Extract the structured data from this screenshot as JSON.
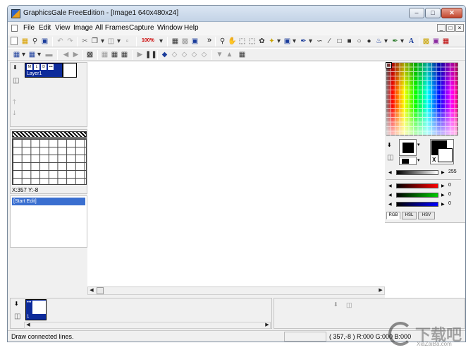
{
  "window": {
    "title": "GraphicsGale FreeEdition - [Image1 640x480x24]",
    "minimize_glyph": "–",
    "maximize_glyph": "□",
    "close_glyph": "✕"
  },
  "menu": [
    "File",
    "Edit",
    "View",
    "Image",
    "All Frames",
    "Capture",
    "Window",
    "Help"
  ],
  "mdi_controls": [
    "_",
    "□",
    "×"
  ],
  "toolbar1": {
    "zoom_label": "100%",
    "overflow_glyph": "»"
  },
  "layers": {
    "layer_name": "Layer1",
    "checkbox_labels": [
      "M",
      "L",
      "D",
      "•••"
    ]
  },
  "coords": "X:357 Y:-8",
  "history": {
    "selected_item": "[Start Edit]"
  },
  "color_panel": {
    "scale_max": "255",
    "red_value": "0",
    "green_value": "0",
    "blue_value": "0",
    "tabs": [
      "RGB",
      "HSL",
      "HSV"
    ],
    "swap_label": "X"
  },
  "frames": {
    "frame_number": "1",
    "frame_dots": "•••"
  },
  "status": {
    "message": "Draw connected lines.",
    "coords": "( 357,-8 ) R:000 G:000 B:000"
  },
  "watermark": {
    "brand_cn": "下载吧",
    "brand_url": "XiaZaiBa.com"
  },
  "colors": {
    "selection_blue": "#3a6fd0",
    "layer_blue": "#0c2a9a",
    "title_gradient_top": "#dbe6f3",
    "panel_bg": "#f0f0f0"
  }
}
